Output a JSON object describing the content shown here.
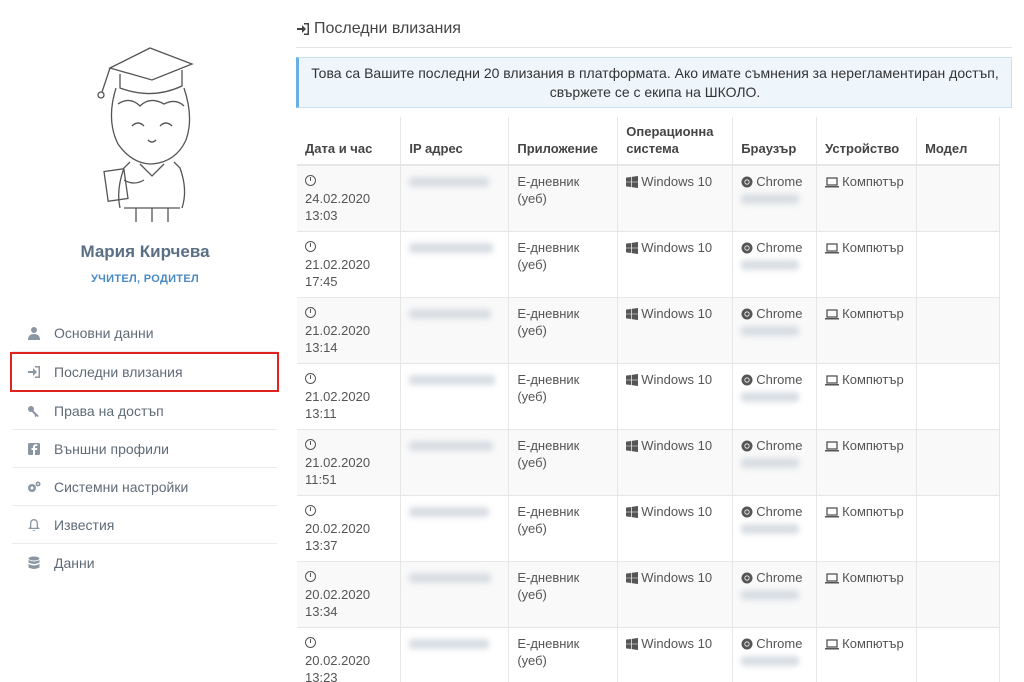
{
  "user": {
    "name": "Мария Кирчева",
    "role": "УЧИТЕЛ, РОДИТЕЛ"
  },
  "menu": [
    {
      "label": "Основни данни",
      "icon": "user-icon",
      "active": false
    },
    {
      "label": "Последни влизания",
      "icon": "sign-in-icon",
      "active": true
    },
    {
      "label": "Права на достъп",
      "icon": "key-icon",
      "active": false
    },
    {
      "label": "Външни профили",
      "icon": "facebook-icon",
      "active": false
    },
    {
      "label": "Системни настройки",
      "icon": "cogs-icon",
      "active": false
    },
    {
      "label": "Известия",
      "icon": "bell-icon",
      "active": false
    },
    {
      "label": "Данни",
      "icon": "database-icon",
      "active": false
    }
  ],
  "page": {
    "title": "Последни влизания",
    "info": "Това са Вашите последни 20 влизания в платформата. Ако имате съмнения за нерегламентиран достъп, свържете се с екипа на ШКОЛО."
  },
  "table": {
    "headers": [
      "Дата и час",
      "IP адрес",
      "Приложение",
      "Операционна система",
      "Браузър",
      "Устройство",
      "Модел"
    ],
    "rows": [
      {
        "date": "24.02.2020",
        "time": "13:03",
        "app": "Е-дневник (уеб)",
        "os": "Windows 10",
        "browser": "Chrome",
        "device": "Компютър"
      },
      {
        "date": "21.02.2020",
        "time": "17:45",
        "app": "Е-дневник (уеб)",
        "os": "Windows 10",
        "browser": "Chrome",
        "device": "Компютър"
      },
      {
        "date": "21.02.2020",
        "time": "13:14",
        "app": "Е-дневник (уеб)",
        "os": "Windows 10",
        "browser": "Chrome",
        "device": "Компютър"
      },
      {
        "date": "21.02.2020",
        "time": "13:11",
        "app": "Е-дневник (уеб)",
        "os": "Windows 10",
        "browser": "Chrome",
        "device": "Компютър"
      },
      {
        "date": "21.02.2020",
        "time": "11:51",
        "app": "Е-дневник (уеб)",
        "os": "Windows 10",
        "browser": "Chrome",
        "device": "Компютър"
      },
      {
        "date": "20.02.2020",
        "time": "13:37",
        "app": "Е-дневник (уеб)",
        "os": "Windows 10",
        "browser": "Chrome",
        "device": "Компютър"
      },
      {
        "date": "20.02.2020",
        "time": "13:34",
        "app": "Е-дневник (уеб)",
        "os": "Windows 10",
        "browser": "Chrome",
        "device": "Компютър"
      },
      {
        "date": "20.02.2020",
        "time": "13:23",
        "app": "Е-дневник (уеб)",
        "os": "Windows 10",
        "browser": "Chrome",
        "device": "Компютър"
      }
    ]
  },
  "colors": {
    "active_border": "#e0221f",
    "info_bg": "#eef6fc",
    "role": "#4a8ac4",
    "name": "#5a6f85"
  }
}
